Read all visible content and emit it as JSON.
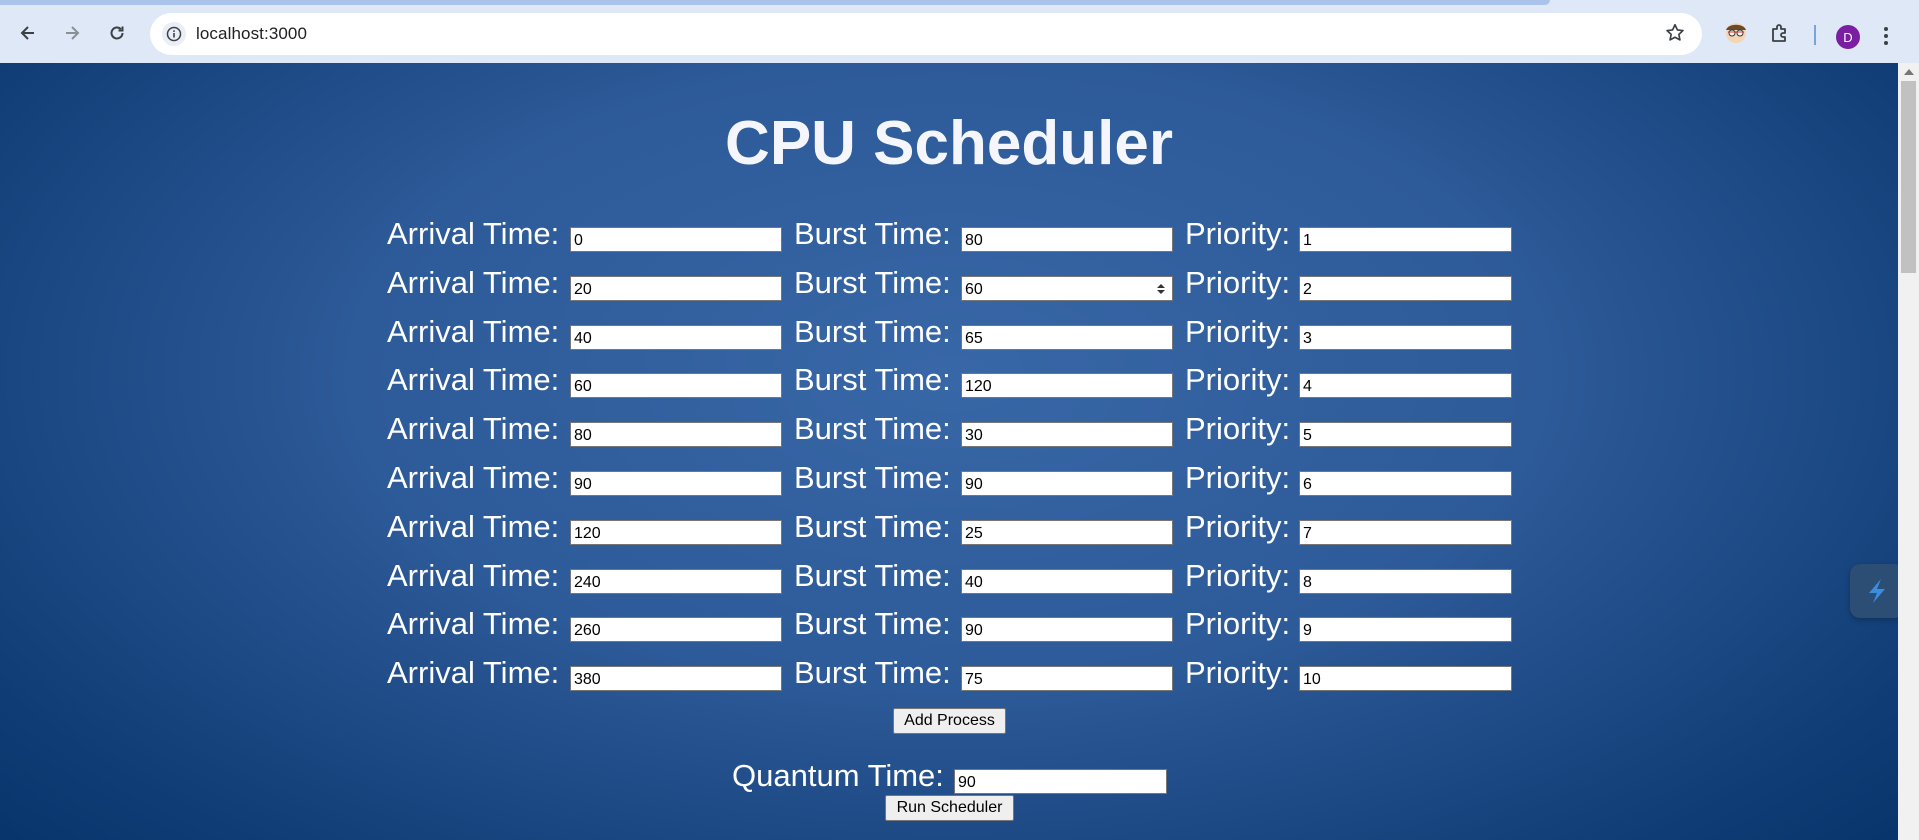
{
  "browser": {
    "url": "localhost:3000",
    "profile_initial": "D",
    "icons": {
      "back": "back-arrow-icon",
      "forward": "forward-arrow-icon",
      "reload": "reload-icon",
      "site_info": "site-info-icon",
      "bookmark": "star-icon",
      "extension_avatar": "extension-avatar-icon",
      "extensions": "puzzle-icon",
      "menu": "kebab-menu-icon"
    }
  },
  "page": {
    "title": "CPU Scheduler",
    "labels": {
      "arrival": "Arrival Time:",
      "burst": "Burst Time:",
      "priority": "Priority:"
    },
    "processes": [
      {
        "arrival": "0",
        "burst": "80",
        "priority": "1"
      },
      {
        "arrival": "20",
        "burst": "60",
        "priority": "2"
      },
      {
        "arrival": "40",
        "burst": "65",
        "priority": "3"
      },
      {
        "arrival": "60",
        "burst": "120",
        "priority": "4"
      },
      {
        "arrival": "80",
        "burst": "30",
        "priority": "5"
      },
      {
        "arrival": "90",
        "burst": "90",
        "priority": "6"
      },
      {
        "arrival": "120",
        "burst": "25",
        "priority": "7"
      },
      {
        "arrival": "240",
        "burst": "40",
        "priority": "8"
      },
      {
        "arrival": "260",
        "burst": "90",
        "priority": "9"
      },
      {
        "arrival": "380",
        "burst": "75",
        "priority": "10"
      }
    ],
    "add_process_label": "Add Process",
    "quantum_label": "Quantum Time:",
    "quantum_value": "90",
    "run_label": "Run Scheduler"
  },
  "colors": {
    "background_center": "#3867a7",
    "background_edge": "#06346a",
    "label_text": "#ffffff",
    "title_text": "#f4f6fb"
  }
}
